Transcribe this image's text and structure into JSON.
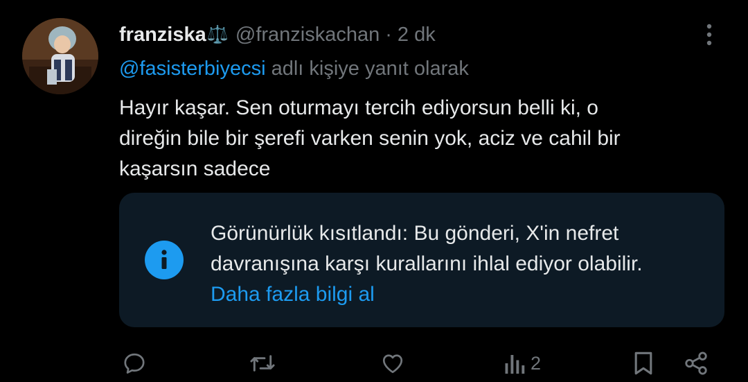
{
  "tweet": {
    "author_name": "franziska",
    "author_badge": "⚖️",
    "handle": "@franziskachan",
    "separator": "·",
    "time": "2 dk",
    "reply_to_user": "@fasisterbiyecsi",
    "reply_to_suffix": "adlı kişiye yanıt olarak",
    "text_lines": [
      "Hayır kaşar. Sen oturmayı tercih ediyorsun belli ki, o",
      "direğin bile bir şerefi varken senin yok, aciz ve cahil bir",
      "kaşarsın sadece"
    ]
  },
  "notice": {
    "lines": [
      "Görünürlük kısıtlandı: Bu gönderi, X'in nefret",
      "davranışına karşı kurallarını ihlal ediyor olabilir."
    ],
    "link": "Daha fazla bilgi al"
  },
  "actions": {
    "views_count": "2",
    "icons": [
      "reply-icon",
      "retweet-icon",
      "like-icon",
      "views-icon",
      "bookmark-icon",
      "share-icon"
    ]
  },
  "colors": {
    "background": "#000000",
    "text": "#e7e9ea",
    "muted": "#71767b",
    "accent": "#1d9bf0",
    "notice_bg": "#0d1a25"
  }
}
